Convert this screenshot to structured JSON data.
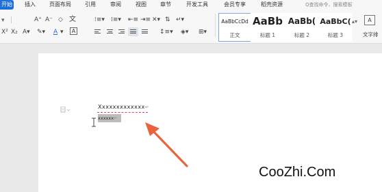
{
  "menu": {
    "tabs": [
      "开始",
      "插入",
      "页面布局",
      "引用",
      "审阅",
      "视图",
      "章节",
      "开发工具",
      "会员专享",
      "稻壳资源"
    ],
    "search_placeholder": "Q查找命令、搜索模板"
  },
  "toolbar": {
    "font_size_symbols": [
      "A⁺",
      "A⁻"
    ],
    "clear_format": "◇",
    "pinyin": "文",
    "superscript": "X²",
    "subscript": "X₂",
    "font_color": "A",
    "highlight": "ab",
    "border_text": "A",
    "char_border": "A",
    "line_spacing": "↕",
    "shading": "◈",
    "table_border": "⊞"
  },
  "styles": [
    {
      "sample": "AaBbCcDd",
      "name": "正文",
      "selected": true
    },
    {
      "sample": "AaBb",
      "name": "标题 1",
      "selected": false
    },
    {
      "sample": "AaBb(",
      "name": "标题 2",
      "selected": false
    },
    {
      "sample": "AaBbC(",
      "name": "标题 3",
      "selected": false
    }
  ],
  "text_layout_button": "文字排",
  "document": {
    "line1": "Xxxxxxxxxxxxx",
    "line1_mark": "↵",
    "line2": "xxxxxx",
    "line2_mark": "↵"
  },
  "watermark": "CooZhi.Com",
  "colors": {
    "accent": "#1f6fd8",
    "arrow": "#e8643c",
    "selection": "#bdbdbd"
  }
}
